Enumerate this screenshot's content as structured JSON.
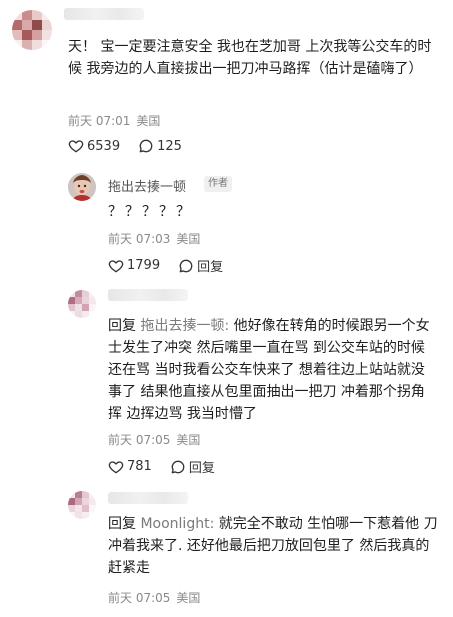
{
  "comments": [
    {
      "text": "天！ 宝一定要注意安全 我也在芝加哥 上次我等公交车的时候 我旁边的人直接拔出一把刀冲马路挥（估计是磕嗨了）",
      "date": "前天 07:01",
      "location": "美国",
      "likes": "6539",
      "replies": "125"
    },
    {
      "username": "拖出去揍一顿",
      "badge": "作者",
      "text": "？？？？？",
      "date": "前天 07:03",
      "location": "美国",
      "likes": "1799",
      "reply_label": "回复"
    },
    {
      "reply_prefix": "回复",
      "reply_target": "拖出去揍一顿:",
      "text": "他好像在转角的时候跟另一个女士发生了冲突 然后嘴里一直在骂 到公交车站的时候还在骂 当时我看公交车快来了 想着往边上站站就没事了 结果他直接从包里面抽出一把刀 冲着那个拐角挥 边挥边骂 我当时懵了",
      "date": "前天 07:05",
      "location": "美国",
      "likes": "781",
      "reply_label": "回复"
    },
    {
      "reply_prefix": "回复",
      "reply_target": "Moonlight:",
      "text": "就完全不敢动 生怕哪一下惹着他 刀冲着我来了. 还好他最后把刀放回包里了 然后我真的 赶紧走",
      "date": "前天 07:05",
      "location": "美国"
    }
  ],
  "colors": {
    "text": "#1e1e1e",
    "meta": "#8a8a8a",
    "reply_target": "#7a7a7a"
  },
  "icons": {
    "like": "heart-outline-icon",
    "comment": "speech-bubble-icon"
  }
}
